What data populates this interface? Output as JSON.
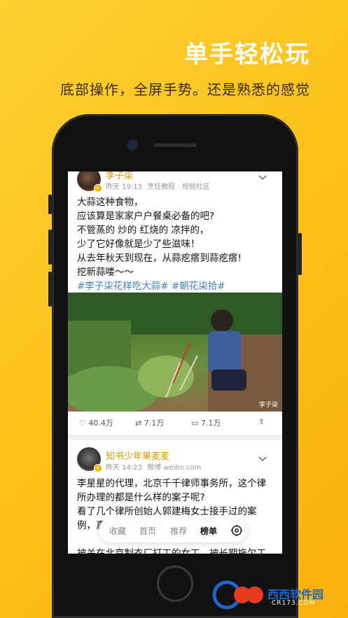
{
  "promo": {
    "headline": "单手轻松玩",
    "subline": "底部操作，全屏手势。还是熟悉的感觉"
  },
  "feed": [
    {
      "author": "李子柒",
      "time": "昨天 19:13",
      "source": "烹饪教程 · 视频社区",
      "lines": [
        "大蒜这种食物，",
        "应该算是家家户户餐桌必备的吧?",
        "不管蒸的 炒的 红烧的 凉拌的，",
        "少了它好像就是少了些滋味！",
        "从去年秋天到现在，从蒜疙瘩到蒜疙瘩!",
        "挖新蒜喽～～"
      ],
      "tags": "#李子柒花样吃大蒜# #朝花柒拾#",
      "photo_caption": "李子柒",
      "likes": "40.4万",
      "reposts": "7.1万",
      "comments": "7.1万"
    },
    {
      "author": "知书少年果麦麦",
      "time": "昨天 14:23",
      "source": "微博 weibo.com",
      "lines": [
        "李星星的代理，北京千千律师事务所，这个律",
        "所办理的都是什么样的案子呢?",
        "看了几个律所创始人郭建梅女士接手过的案",
        "例，真的有被感动到:",
        "",
        "被关在北京制衣厂打工的女工，被长期拖欠工"
      ]
    }
  ],
  "bottom_nav": [
    "收藏",
    "首页",
    "推荐",
    "榜单"
  ],
  "watermark": {
    "brand": "西西软件园",
    "site": "CR173.COM"
  },
  "colors": {
    "accent": "#e09b00",
    "tag": "#3f7fca",
    "background": "#fbbf18"
  }
}
